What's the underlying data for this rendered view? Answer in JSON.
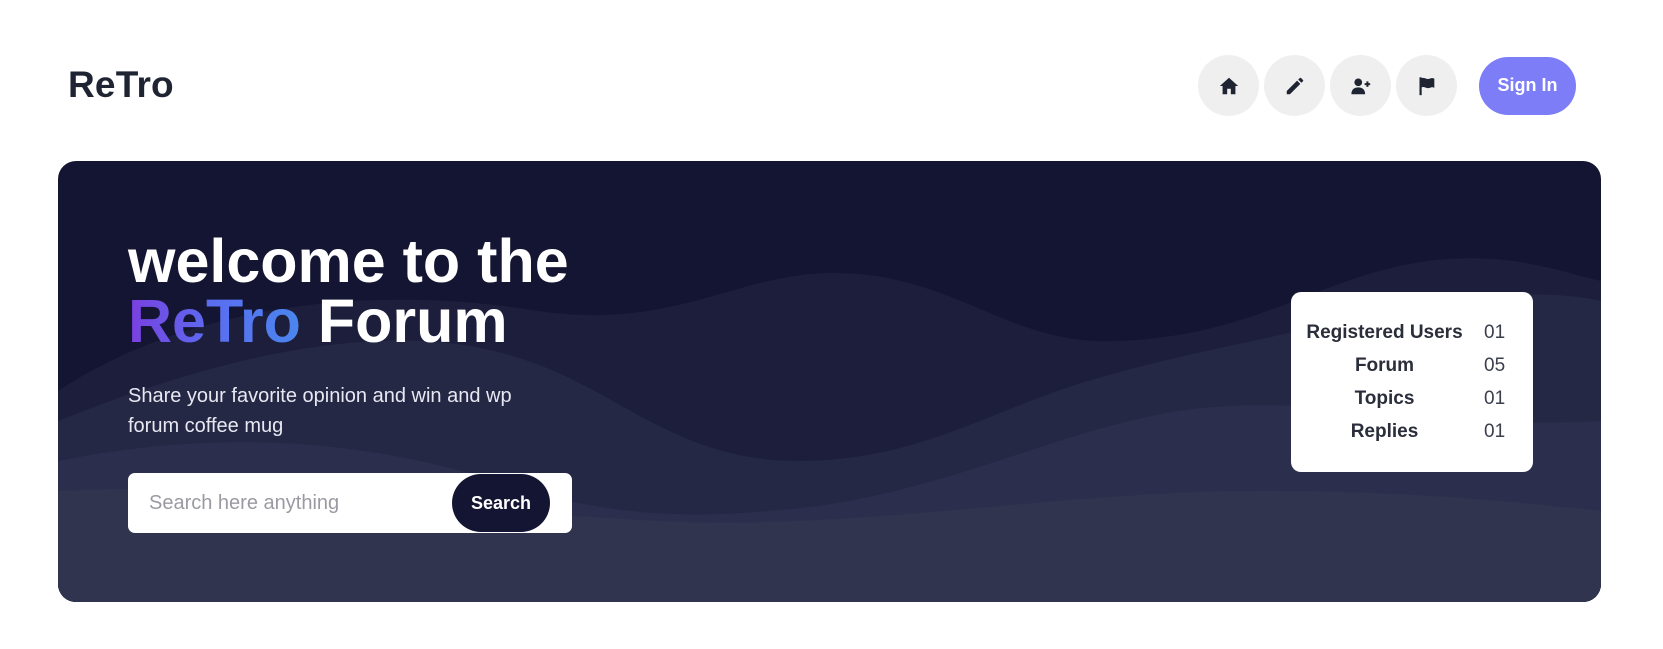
{
  "header": {
    "logo": "ReTro",
    "nav_icons": [
      "home-icon",
      "pencil-icon",
      "user-plus-icon",
      "flag-icon"
    ],
    "signin_label": "Sign In"
  },
  "hero": {
    "title_line1": "welcome to the",
    "title_brand": "ReTro",
    "title_rest": "Forum",
    "subtitle": "Share your favorite opinion and win and wp forum coffee mug",
    "search": {
      "placeholder": "Search here anything",
      "button_label": "Search"
    },
    "stats": [
      {
        "label": "Registered Users",
        "value": "01"
      },
      {
        "label": "Forum",
        "value": "05"
      },
      {
        "label": "Topics",
        "value": "01"
      },
      {
        "label": "Replies",
        "value": "01"
      }
    ]
  },
  "colors": {
    "accent": "#7d7df8",
    "hero_bg": "#141532",
    "brand_gradient_start": "#7a3fe0",
    "brand_gradient_end": "#4a86ee"
  }
}
